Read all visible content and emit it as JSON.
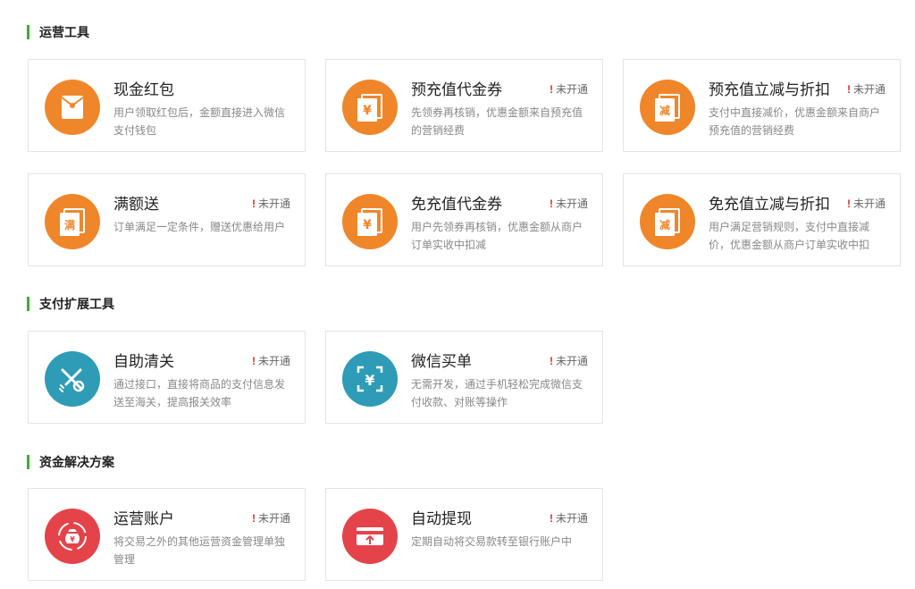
{
  "sections": [
    {
      "title": "运营工具",
      "cards": [
        {
          "name": "现金红包",
          "status": "",
          "desc": "用户领取红包后，金额直接进入微信支付钱包",
          "icon": "red-envelope-icon"
        },
        {
          "name": "预充值代金券",
          "status": "未开通",
          "desc": "先领券再核销，优惠金额来自预充值的营销经费",
          "icon": "yuan-voucher-icon"
        },
        {
          "name": "预充值立减与折扣",
          "status": "未开通",
          "desc": "支付中直接减价，优惠金额来自商户预充值的营销经费",
          "icon": "discount-voucher-icon",
          "glyph": "减"
        },
        {
          "name": "满额送",
          "status": "未开通",
          "desc": "订单满足一定条件，赠送优惠给用户",
          "icon": "full-gift-voucher-icon",
          "glyph": "满"
        },
        {
          "name": "免充值代金券",
          "status": "未开通",
          "desc": "用户先领券再核销，优惠金额从商户订单实收中扣减",
          "icon": "yuan-voucher-icon"
        },
        {
          "name": "免充值立减与折扣",
          "status": "未开通",
          "desc": "用户满足营销规则，支付中直接减价，优惠金额从商户订单实收中扣",
          "icon": "discount-voucher-icon",
          "glyph": "减"
        }
      ]
    },
    {
      "title": "支付扩展工具",
      "cards": [
        {
          "name": "自助清关",
          "status": "未开通",
          "desc": "通过接口，直接将商品的支付信息发送至海关，提高报关效率",
          "icon": "customs-clearance-icon"
        },
        {
          "name": "微信买单",
          "status": "未开通",
          "desc": "无需开发，通过手机轻松完成微信支付收款、对账等操作",
          "icon": "scan-yuan-icon"
        }
      ]
    },
    {
      "title": "资金解决方案",
      "cards": [
        {
          "name": "运营账户",
          "status": "未开通",
          "desc": "将交易之外的其他运营资金管理单独管理",
          "icon": "money-bag-account-icon"
        },
        {
          "name": "自动提现",
          "status": "未开通",
          "desc": "定期自动将交易款转至银行账户中",
          "icon": "bank-card-withdraw-icon"
        }
      ]
    }
  ],
  "status_mark": "!",
  "colors": {
    "accent": "#3cb034",
    "orange": "#f0862a",
    "blue": "#2e9cb6",
    "red": "#e5434a",
    "status_mark": "#e02b2b"
  }
}
